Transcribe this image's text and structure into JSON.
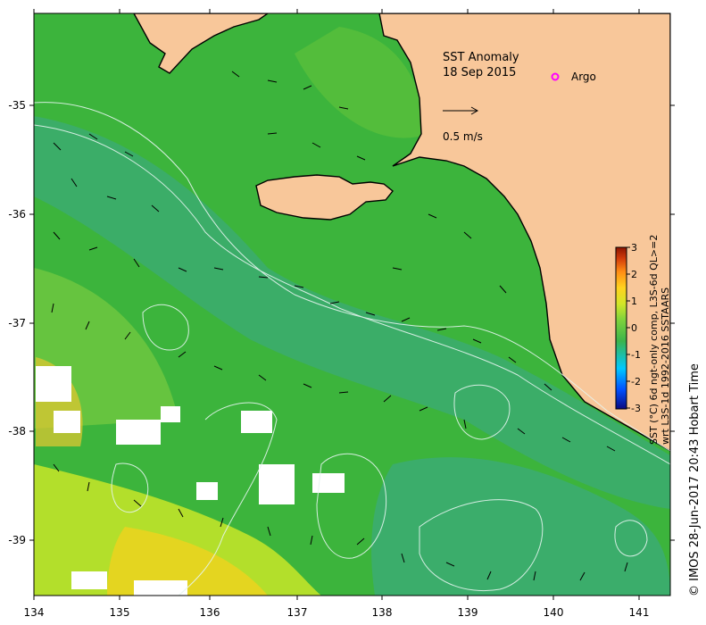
{
  "title": "SST Anomaly",
  "date": "18 Sep 2015",
  "legend": {
    "argo_label": "Argo",
    "argo_color": "#ff00ff"
  },
  "scale_vector": {
    "label": "0.5 m/s"
  },
  "colorbar": {
    "ticks": [
      "3",
      "2",
      "1",
      "0",
      "-1",
      "-2",
      "-3"
    ],
    "title_line1": "SST (°C) 6d ngt-only comp, L3S-6d QL>=2",
    "title_line2": "wrt L3S-1d 1992-2016 SSTAARS",
    "colors": [
      "#0a0a80",
      "#0050ff",
      "#00c8ff",
      "#3cb44b",
      "#7dd23c",
      "#d2e628",
      "#ffd21e",
      "#ff8c14",
      "#d23c0a",
      "#8c1400"
    ]
  },
  "axes": {
    "x_ticks": [
      "134",
      "135",
      "136",
      "137",
      "138",
      "139",
      "140",
      "141"
    ],
    "y_ticks": [
      "-35",
      "-36",
      "-37",
      "-38",
      "-39"
    ]
  },
  "credit": "© IMOS 28-Jun-2017 20:43 Hobart Time",
  "colors": {
    "land": "#f8c79a",
    "ocean": "#3cb43c",
    "coast": "#000000",
    "contour": "#e0f0f0"
  }
}
